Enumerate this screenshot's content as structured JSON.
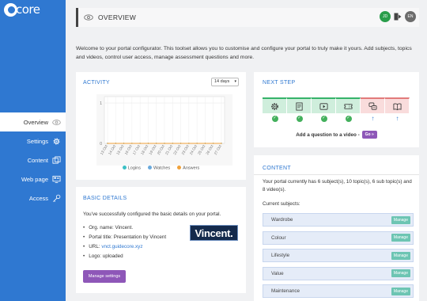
{
  "app": {
    "logo_text": "core"
  },
  "sidebar": {
    "items": [
      {
        "label": "Overview",
        "icon": "eye-icon",
        "active": true
      },
      {
        "label": "Settings",
        "icon": "gear-icon",
        "active": false
      },
      {
        "label": "Content",
        "icon": "layers-icon",
        "active": false
      },
      {
        "label": "Web page",
        "icon": "monitor-icon",
        "active": false
      },
      {
        "label": "Access",
        "icon": "key-icon",
        "active": false
      }
    ]
  },
  "header": {
    "title": "OVERVIEW",
    "avatar_user": "JD",
    "avatar_lang": "EN"
  },
  "welcome": "Welcome to your portal configurator. This toolset allows you to customise and configure your portal to truly make it yours. Add subjects, topics and videos, control user access, manage assessment questions and more.",
  "activity": {
    "title": "ACTIVITY",
    "range": "14 days"
  },
  "chart_data": {
    "type": "line",
    "title": "",
    "x": [
      "13 Oct",
      "14 Oct",
      "15 Oct",
      "16 Oct",
      "17 Oct",
      "18 Oct",
      "19 Oct",
      "20 Oct",
      "21 Oct",
      "22 Oct",
      "23 Oct",
      "24 Oct",
      "25 Oct",
      "26 Oct",
      "27 Oct"
    ],
    "ylim": [
      0,
      1
    ],
    "yticks": [
      0,
      1
    ],
    "grid": true,
    "legend_placement": "bottom",
    "series": [
      {
        "name": "Logins",
        "color": "#3cc0c5",
        "values": [
          0,
          0,
          0,
          0,
          0,
          0,
          0,
          0,
          0,
          0,
          0,
          0,
          0,
          0,
          0
        ]
      },
      {
        "name": "Watches",
        "color": "#6aa9dc",
        "values": [
          0,
          0,
          0,
          0,
          0,
          0,
          0,
          0,
          0,
          0,
          0,
          0,
          0,
          0,
          0
        ]
      },
      {
        "name": "Answers",
        "color": "#f0a13a",
        "values": [
          0,
          0,
          0,
          0,
          0,
          0,
          0,
          0,
          0,
          0,
          0,
          0,
          0,
          0,
          0
        ]
      }
    ]
  },
  "basic": {
    "title": "BASIC DETAILS",
    "intro": "You've successfully configured the basic details on your portal.",
    "org_name": "Org. name: Vincent.",
    "portal_title": "Portal title: Presentation by Vincent",
    "url_label": "URL: ",
    "url": "vnct.guidecore.xyz",
    "logo_status": "Logo: uploaded",
    "logo_text": "Vincent.",
    "button": "Manage settings"
  },
  "next_step": {
    "title": "NEXT STEP",
    "steps": [
      {
        "icon": "gear-icon",
        "done": true
      },
      {
        "icon": "document-icon",
        "done": true
      },
      {
        "icon": "play-icon",
        "done": true
      },
      {
        "icon": "ticket-icon",
        "done": true
      },
      {
        "icon": "chat-icon",
        "done": false
      },
      {
        "icon": "book-icon",
        "done": false
      }
    ],
    "prompt": "Add a question to a video -",
    "button": "Go »"
  },
  "content": {
    "title": "CONTENT",
    "text": "Your portal currently has 6 subject(s), 10 topic(s), 6 sub topic(s) and 8 video(s).",
    "subjects_label": "Current subjects:",
    "manage_label": "Manage",
    "subjects": [
      "Wardrobe",
      "Colour",
      "Lifestyle",
      "Value",
      "Maintenance"
    ]
  },
  "colors": {
    "brand": "#2f78d1",
    "purple_button": "#8e57b8",
    "manage_button": "#6dc5b3",
    "step_done": "#36b36a",
    "step_pending": "#e27b7b"
  }
}
